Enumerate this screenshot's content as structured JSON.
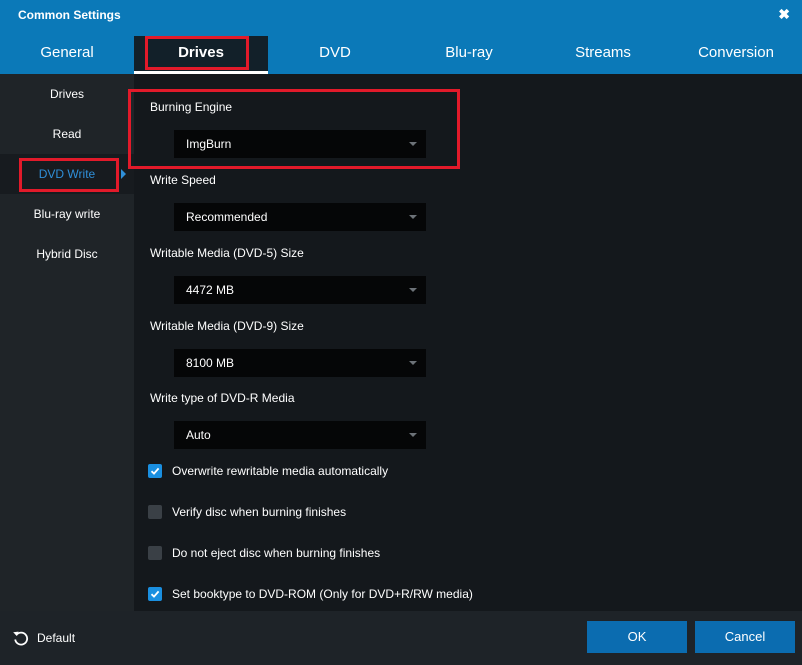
{
  "window": {
    "title": "Common Settings",
    "close_glyph": "✖"
  },
  "tabs": [
    {
      "label": "General"
    },
    {
      "label": "Drives"
    },
    {
      "label": "DVD"
    },
    {
      "label": "Blu-ray"
    },
    {
      "label": "Streams"
    },
    {
      "label": "Conversion"
    }
  ],
  "active_tab": "Drives",
  "sidebar": {
    "items": [
      {
        "label": "Drives"
      },
      {
        "label": "Read"
      },
      {
        "label": "DVD Write"
      },
      {
        "label": "Blu-ray write"
      },
      {
        "label": "Hybrid Disc"
      }
    ],
    "active": "DVD Write"
  },
  "settings": {
    "burning_engine": {
      "label": "Burning Engine",
      "value": "ImgBurn"
    },
    "write_speed": {
      "label": "Write Speed",
      "value": "Recommended"
    },
    "dvd5_size": {
      "label": "Writable Media (DVD-5) Size",
      "value": "4472 MB"
    },
    "dvd9_size": {
      "label": "Writable Media (DVD-9) Size",
      "value": "8100 MB"
    },
    "dvdr_write_type": {
      "label": "Write type of DVD-R Media",
      "value": "Auto"
    },
    "checkboxes": [
      {
        "label": "Overwrite rewritable media automatically",
        "checked": true
      },
      {
        "label": "Verify disc when burning finishes",
        "checked": false
      },
      {
        "label": "Do not eject disc when burning finishes",
        "checked": false
      },
      {
        "label": "Set booktype to DVD-ROM (Only for DVD+R/RW media)",
        "checked": true
      }
    ]
  },
  "footer": {
    "default_label": "Default",
    "ok_label": "OK",
    "cancel_label": "Cancel"
  },
  "icons": {
    "default": "reset-icon",
    "close": "close-icon",
    "checkbox": "checkmark-icon"
  },
  "colors": {
    "titlebar": "#0b79b8",
    "accent": "#1a8fe0",
    "highlight": "#e21a2a",
    "button": "#0b6cb0"
  }
}
